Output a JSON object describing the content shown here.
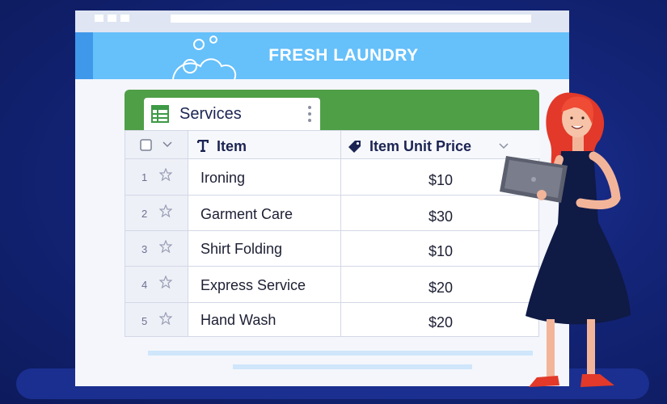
{
  "app": {
    "title": "FRESH LAUNDRY"
  },
  "tab": {
    "label": "Services"
  },
  "columns": {
    "item": "Item",
    "price": "Item Unit Price"
  },
  "rows": [
    {
      "num": "1",
      "item": "Ironing",
      "price": "$10"
    },
    {
      "num": "2",
      "item": "Garment Care",
      "price": "$30"
    },
    {
      "num": "3",
      "item": "Shirt Folding",
      "price": "$10"
    },
    {
      "num": "4",
      "item": "Express Service",
      "price": "$20"
    },
    {
      "num": "5",
      "item": "Hand Wash",
      "price": "$20"
    }
  ],
  "colors": {
    "background": "#14257a",
    "header": "#66c0fa",
    "header_accent": "#3f98ea",
    "tab_band": "#4f9f47",
    "text_dark": "#1b2452"
  },
  "icons": [
    "bubbles-icon",
    "sheet-icon",
    "kebab-menu-icon",
    "checkbox-icon",
    "chevron-down-icon",
    "text-type-icon",
    "tag-icon",
    "star-icon",
    "laptop-icon"
  ]
}
